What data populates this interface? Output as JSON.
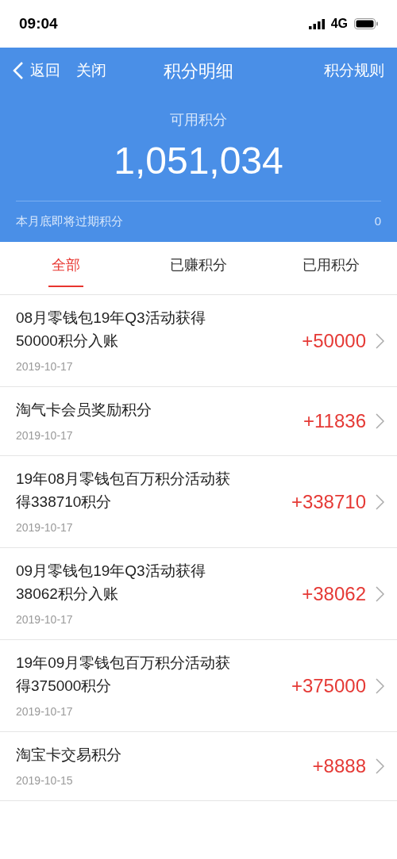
{
  "status_bar": {
    "time": "09:04",
    "network": "4G"
  },
  "nav": {
    "back": "返回",
    "close": "关闭",
    "title": "积分明细",
    "rules": "积分规则"
  },
  "summary": {
    "label": "可用积分",
    "points": "1,051,034",
    "expiring_label": "本月底即将过期积分",
    "expiring_value": "0"
  },
  "tabs": [
    {
      "label": "全部",
      "selected": true
    },
    {
      "label": "已赚积分",
      "selected": false
    },
    {
      "label": "已用积分",
      "selected": false
    }
  ],
  "records": [
    {
      "title": "08月零钱包19年Q3活动获得50000积分入账",
      "date": "2019-10-17",
      "amount": "+50000"
    },
    {
      "title": "淘气卡会员奖励积分",
      "date": "2019-10-17",
      "amount": "+11836"
    },
    {
      "title": "19年08月零钱包百万积分活动获得338710积分",
      "date": "2019-10-17",
      "amount": "+338710"
    },
    {
      "title": "09月零钱包19年Q3活动获得38062积分入账",
      "date": "2019-10-17",
      "amount": "+38062"
    },
    {
      "title": "19年09月零钱包百万积分活动获得375000积分",
      "date": "2019-10-17",
      "amount": "+375000"
    },
    {
      "title": "淘宝卡交易积分",
      "date": "2019-10-15",
      "amount": "+8888"
    }
  ]
}
